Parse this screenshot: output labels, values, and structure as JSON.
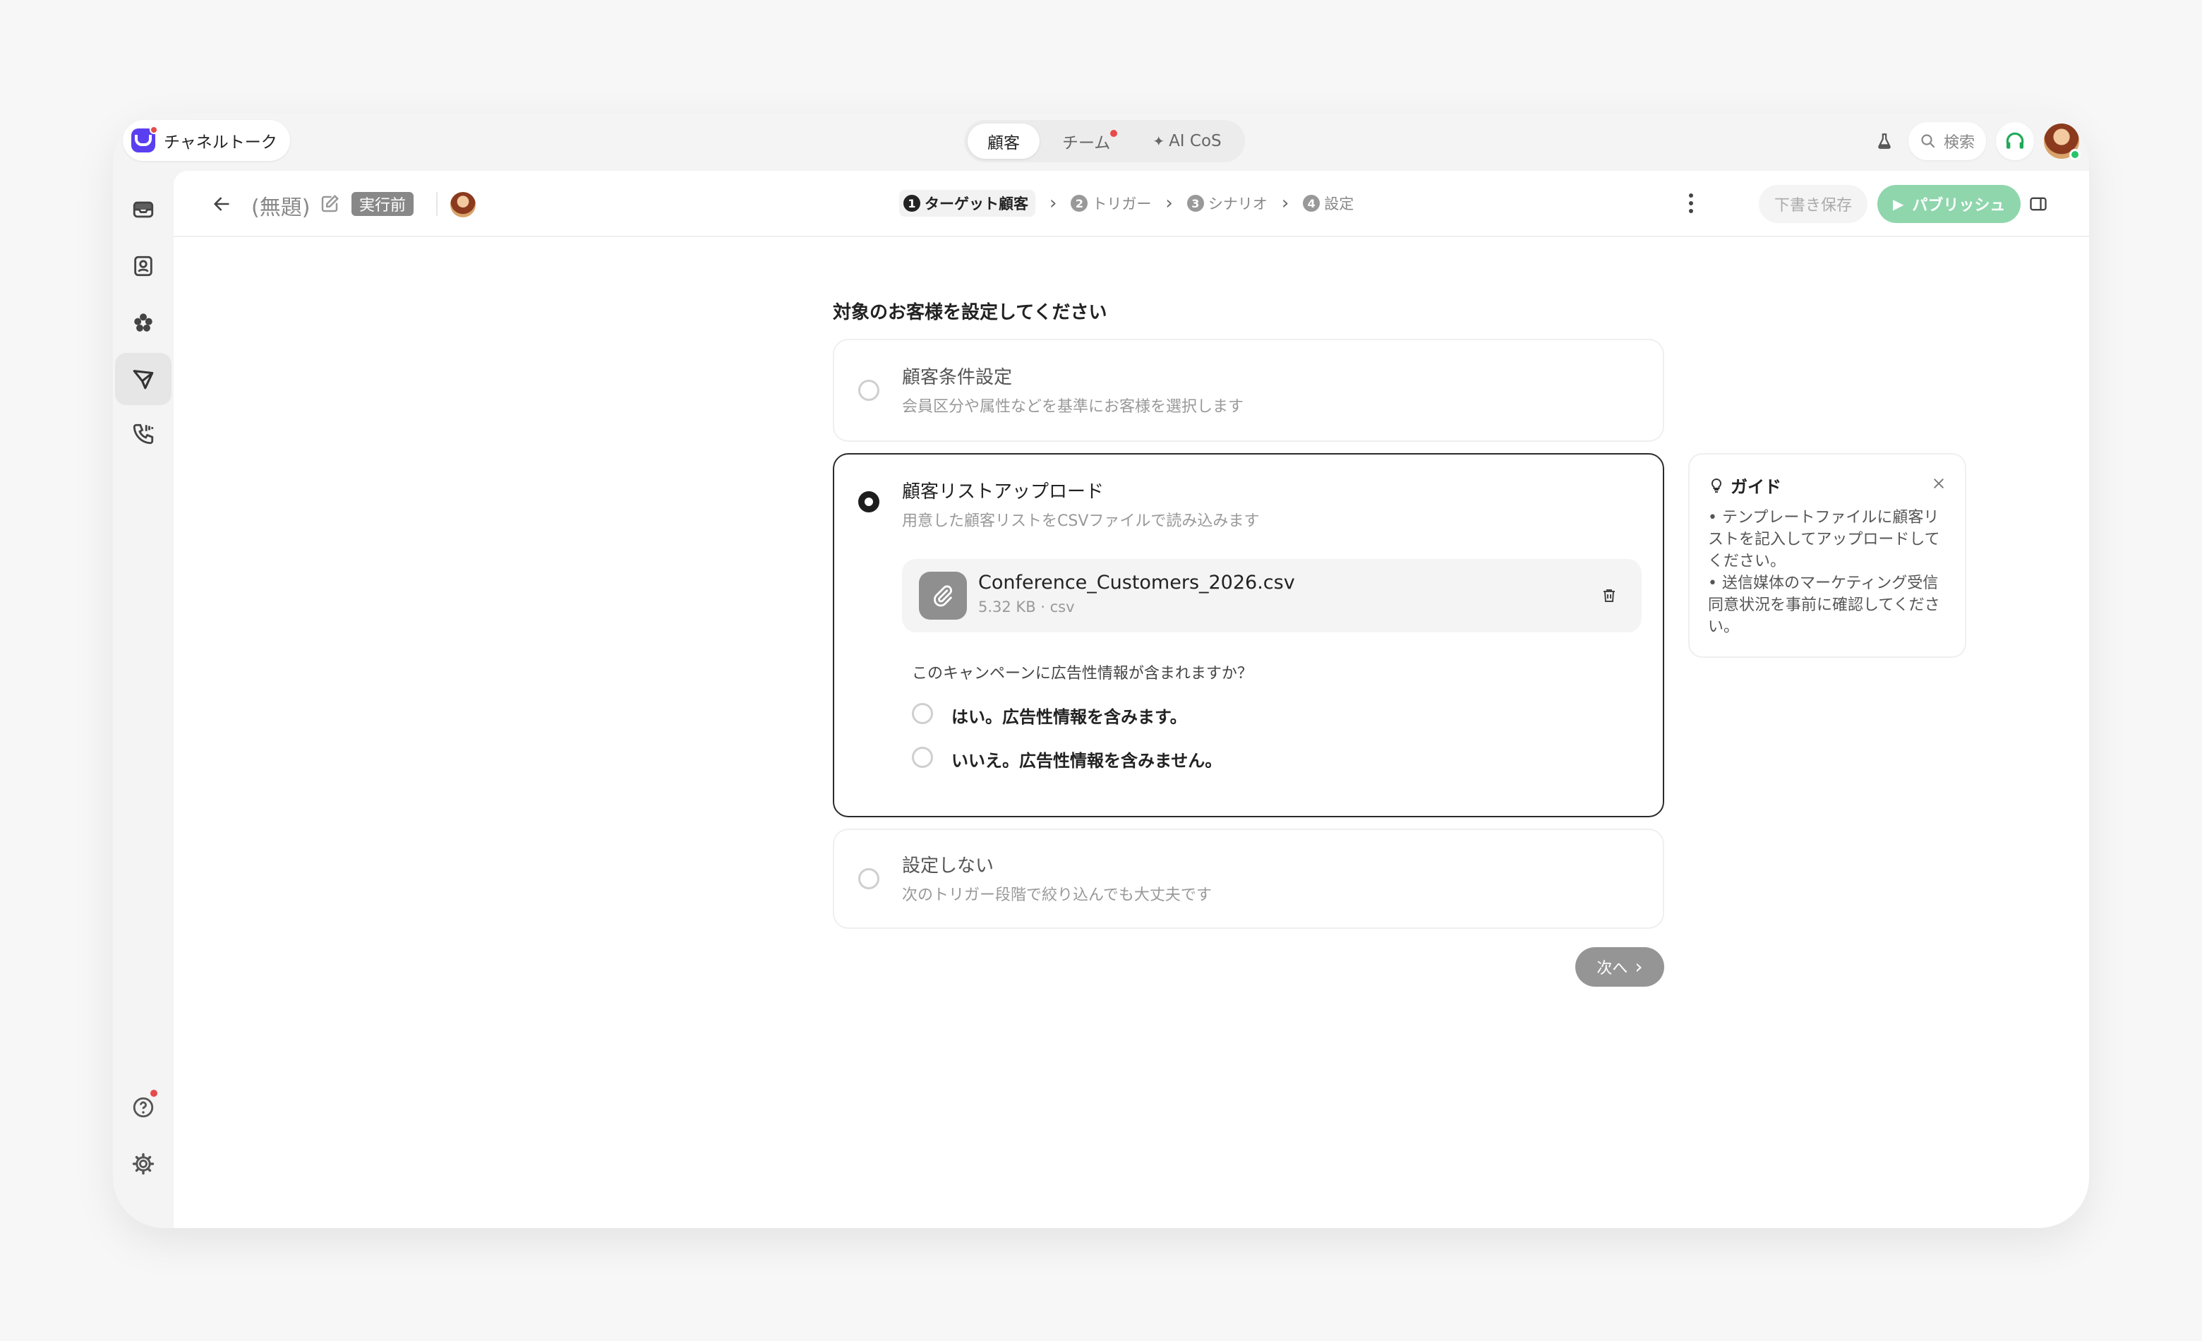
{
  "app": {
    "name": "チャネルトーク",
    "tabs": [
      {
        "label": "顧客"
      },
      {
        "label": "チーム"
      },
      {
        "label": "AI CoS"
      }
    ],
    "search_label": "検索"
  },
  "header": {
    "title": "(無題)",
    "status": "実行前",
    "steps": [
      {
        "num": "1",
        "label": "ターゲット顧客"
      },
      {
        "num": "2",
        "label": "トリガー"
      },
      {
        "num": "3",
        "label": "シナリオ"
      },
      {
        "num": "4",
        "label": "設定"
      }
    ],
    "draft_label": "下書き保存",
    "publish_label": "パブリッシュ"
  },
  "content": {
    "section_title": "対象のお客様を設定してください",
    "options": [
      {
        "title": "顧客条件設定",
        "desc": "会員区分や属性などを基準にお客様を選択します",
        "selected": false
      },
      {
        "title": "顧客リストアップロード",
        "desc": "用意した顧客リストをCSVファイルで読み込みます",
        "selected": true
      },
      {
        "title": "設定しない",
        "desc": "次のトリガー段階で絞り込んでも大丈夫です",
        "selected": false
      }
    ],
    "file": {
      "name": "Conference_Customers_2026.csv",
      "meta": "5.32 KB · csv"
    },
    "question": "このキャンペーンに広告性情報が含まれますか？",
    "answers": [
      {
        "label": "はい。広告性情報を含みます。"
      },
      {
        "label": "いいえ。広告性情報を含みません。"
      }
    ],
    "next_label": "次へ"
  },
  "guide": {
    "title": "ガイド",
    "items": [
      "テンプレートファイルに顧客リストを記入してアップロードしてください。",
      "送信媒体のマーケティング受信同意状況を事前に確認してください。"
    ]
  },
  "colors": {
    "brand": "#5a3ff0",
    "publish": "#8fd6ad",
    "notification": "#e84a4a",
    "online": "#27c46a"
  }
}
